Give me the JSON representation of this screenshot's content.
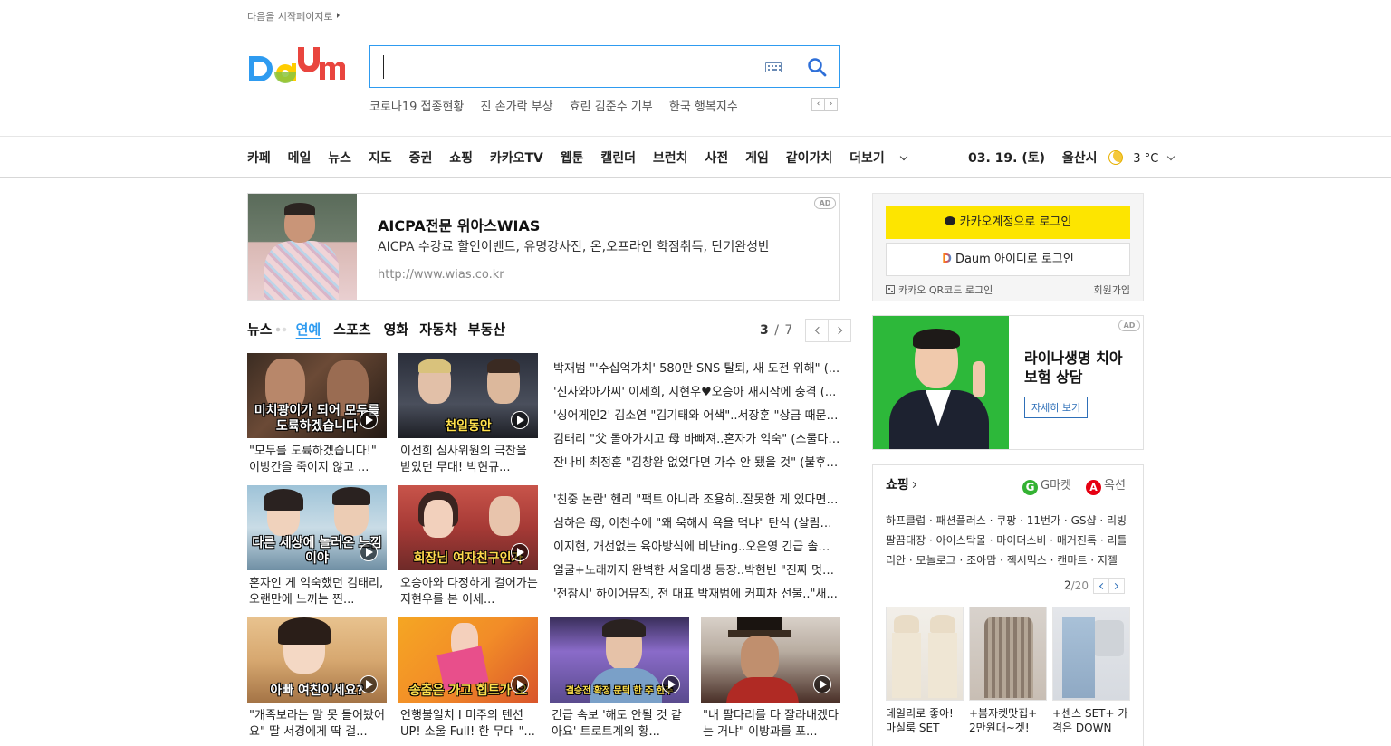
{
  "top": {
    "set_home": "다음을 시작페이지로"
  },
  "search": {
    "placeholder": "",
    "trends": [
      "코로나19 접종현황",
      "진 손가락 부상",
      "효린 김준수 기부",
      "한국 행복지수"
    ]
  },
  "gnb": {
    "items": [
      "카페",
      "메일",
      "뉴스",
      "지도",
      "증권",
      "쇼핑",
      "카카오TV",
      "웹툰",
      "캘린더",
      "브런치",
      "사전",
      "게임",
      "같이가치",
      "더보기"
    ],
    "date": "03. 19. (토)",
    "location": "울산시",
    "temperature": "3 °C"
  },
  "ad_top": {
    "title": "AICPA전문 위아스WIAS",
    "desc": "AICPA 수강료 할인이벤트, 유명강사진, 온,오프라인 학점취득, 단기완성반",
    "url": "http://www.wias.co.kr",
    "badge": "AD"
  },
  "news": {
    "tabs": [
      "뉴스",
      "연예",
      "스포츠",
      "영화",
      "자동차",
      "부동산"
    ],
    "active_tab": "연예",
    "page_current": "3",
    "page_sep": "/",
    "page_total": "7",
    "thumbs": [
      {
        "overlay": "미치광이가 되어 모두를 도륙하겠습니다",
        "caption": "\"모두를 도륙하겠습니다!\" 이방간을 죽이지 않고 ..."
      },
      {
        "overlay": "천일동안",
        "caption": "이선희 심사위원의 극찬을 받았던 무대! 박현규..."
      },
      {
        "overlay": "다른 세상에 놀러온 느낌이야",
        "caption": "혼자인 게 익숙했던 김태리, 오랜만에 느끼는 찐..."
      },
      {
        "overlay": "회장님 여자친구인가",
        "caption": "오승아와 다정하게 걸어가는 지현우를 본 이세..."
      },
      {
        "overlay": "아빠 여친이세요?",
        "caption": "\"개족보라는 말 못 들어봤어요\" 딸 서경에게 딱 걸..."
      },
      {
        "overlay": "송춤은 가고 힙트가 오",
        "caption": "언행불일치 I 미주의 텐션 UP! 소울 Full! 한 무대 \"..."
      },
      {
        "overlay": "결승전 확정 문턱 한 주 한주",
        "caption": "긴급 속보 '해도 안될 것 같아요' 트로트계의 황..."
      },
      {
        "overlay": "",
        "caption": "\"내 팔다리를 다 잘라내겠다는 거냐\" 이방과를 포..."
      }
    ],
    "headlines": [
      "박재범 \"'수십억가치' 580만 SNS 탈퇴, 새 도전 위해\" (...",
      "'신사와아가씨' 이세희, 지현우♥오승아 새시작에 충격 (...",
      "'싱어게인2' 김소연 \"김기태와 어색\"..서장훈 \"상금 때문에...",
      "김태리 \"父 돌아가시고 母 바빠져..혼자가 익숙\" (스물다섯...",
      "잔나비 최정훈 \"김창완 없었다면 가수 안 됐을 것\" (불후의...",
      "'친중 논란' 헨리 \"팩트 아니라 조용히..잘못한 게 있다면\"...",
      "심하은 母, 이천수에 \"왜 욱해서 욕을 먹냐\" 탄식 (살림남)...",
      "이지현, 개선없는 육아방식에 비난ing..오은영 긴급 솔루션...",
      "얼굴+노래까지 완벽한 서울대생 등장..박현빈 \"진짜 멋지다...",
      "'전참시' 하이어뮤직, 전 대표 박재범에 커피차 선물..\"새..."
    ]
  },
  "login": {
    "kakao_label": "카카오계정으로 로그인",
    "daum_label": "아이디로 로그인",
    "daum_word": "Daum",
    "qr_label": "카카오 QR코드 로그인",
    "signup_label": "회원가입"
  },
  "ad_side": {
    "title": "라이나생명 치아보험 상담",
    "more": "자세히 보기",
    "badge": "AD"
  },
  "shopping": {
    "title": "쇼핑",
    "gmarket": "G마켓",
    "auction": "옥션",
    "links": "하프클럽 · 패션플러스 · 쿠팡 · 11번가 · GS샵 · 리빙팔끔대장 · 아이스탁몰 · 마이더스비 · 매거진톡 · 리틀리안 · 모놀로그 · 조아맘 · 젝시믹스 · 캔마트 · 지젤",
    "page_current": "2",
    "page_total": "/20",
    "products": [
      {
        "caption": "데일리로 좋아! 마실룩 SET"
      },
      {
        "caption": "+봄자켓맛집+ 2만원대~겟!"
      },
      {
        "caption": "+센스 SET+ 가격은 DOWN"
      }
    ]
  }
}
